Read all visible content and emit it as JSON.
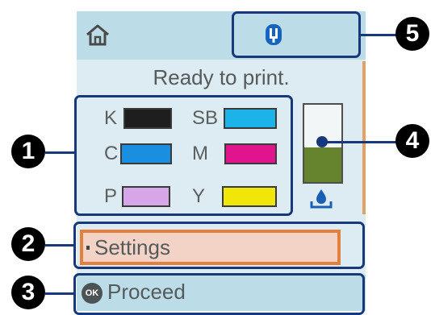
{
  "status": {
    "message": "Ready to print."
  },
  "inks": [
    {
      "label": "K",
      "color": "#1e1e1e",
      "level": 1.0
    },
    {
      "label": "SB",
      "color": "#1cb4e8",
      "level": 1.0
    },
    {
      "label": "C",
      "color": "#1a8fe0",
      "level": 1.0
    },
    {
      "label": "M",
      "color": "#e0148c",
      "level": 1.0
    },
    {
      "label": "P",
      "color": "#d6a6e8",
      "level": 1.0
    },
    {
      "label": "Y",
      "color": "#f0e60a",
      "level": 1.0
    }
  ],
  "maintenance_box": {
    "fill_color": "#66832e",
    "level": 0.45
  },
  "buttons": {
    "settings_label": "Settings",
    "ok_icon_text": "OK",
    "proceed_label": "Proceed"
  },
  "callouts": [
    "1",
    "2",
    "3",
    "4",
    "5"
  ],
  "colors": {
    "highlight": "#e47f3d",
    "callout": "#17387a",
    "screen_bg": "#dcecf2"
  }
}
